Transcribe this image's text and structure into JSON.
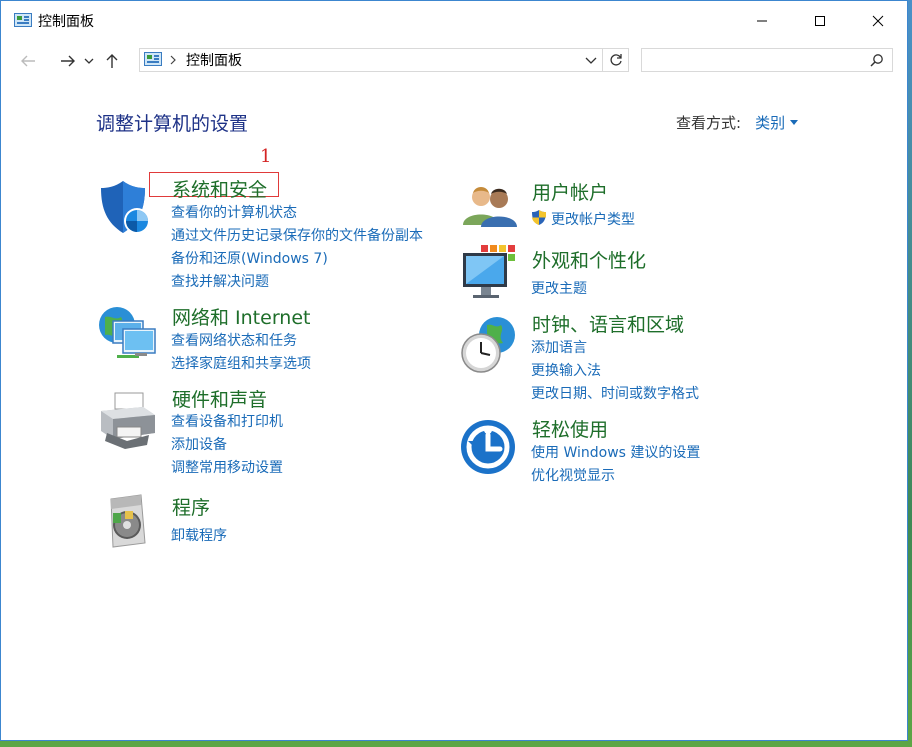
{
  "window": {
    "title": "控制面板"
  },
  "address": {
    "crumb": "控制面板"
  },
  "search": {
    "value": "",
    "placeholder": ""
  },
  "heading": "调整计算机的设置",
  "view_by": {
    "label": "查看方式:",
    "value": "类别"
  },
  "annotation": {
    "number": "1"
  },
  "categories": [
    {
      "title": "系统和安全",
      "icon": "shield-icon",
      "links": [
        "查看你的计算机状态",
        "通过文件历史记录保存你的文件备份副本",
        "备份和还原(Windows 7)",
        "查找并解决问题"
      ]
    },
    {
      "title": "网络和 Internet",
      "icon": "network-globe-icon",
      "links": [
        "查看网络状态和任务",
        "选择家庭组和共享选项"
      ]
    },
    {
      "title": "硬件和声音",
      "icon": "printer-icon",
      "links": [
        "查看设备和打印机",
        "添加设备",
        "调整常用移动设置"
      ]
    },
    {
      "title": "程序",
      "icon": "programs-disc-icon",
      "links": [
        "卸载程序"
      ]
    },
    {
      "title": "用户帐户",
      "icon": "users-icon",
      "links": [
        "更改帐户类型"
      ]
    },
    {
      "title": "外观和个性化",
      "icon": "monitor-color-icon",
      "links": [
        "更改主题"
      ]
    },
    {
      "title": "时钟、语言和区域",
      "icon": "clock-globe-icon",
      "links": [
        "添加语言",
        "更换输入法",
        "更改日期、时间或数字格式"
      ]
    },
    {
      "title": "轻松使用",
      "icon": "ease-of-access-icon",
      "links": [
        "使用 Windows 建议的设置",
        "优化视觉显示"
      ]
    }
  ],
  "colors": {
    "category_title": "#1e6e2a",
    "link": "#1a6bb8",
    "heading": "#1e3287",
    "annotation": "#e03a3a"
  }
}
